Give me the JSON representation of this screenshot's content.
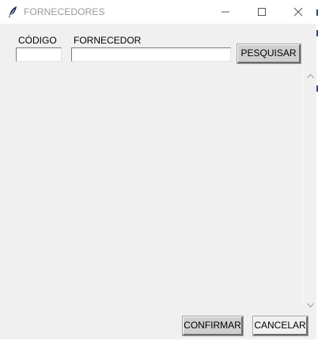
{
  "window": {
    "title": "FORNECEDORES",
    "controls": {
      "minimize": "minimize",
      "maximize": "maximize",
      "close": "close"
    }
  },
  "form": {
    "codigo_label": "CÓDIGO",
    "codigo_value": "",
    "fornecedor_label": "FORNECEDOR",
    "fornecedor_value": "",
    "search_label": "PESQUISAR"
  },
  "footer": {
    "confirm_label": "CONFIRMAR",
    "cancel_label": "CANCELAR"
  },
  "icons": {
    "app": "feather-icon",
    "scroll_up": "chevron-up-icon",
    "scroll_down": "chevron-down-icon"
  }
}
